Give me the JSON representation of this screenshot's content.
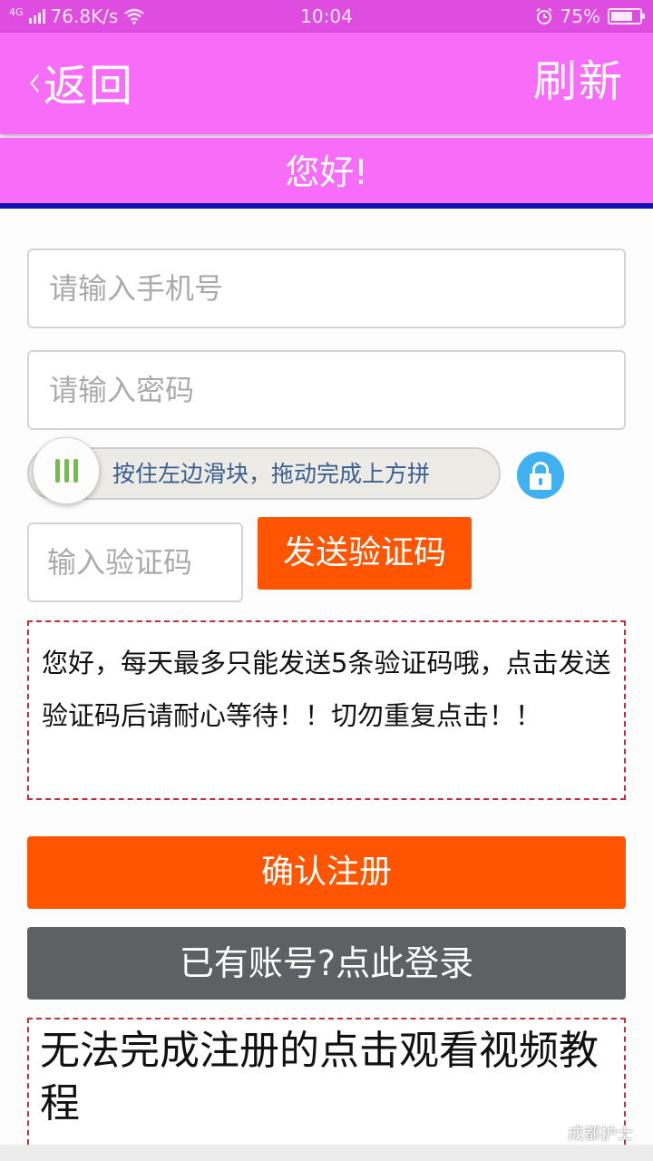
{
  "status_bar": {
    "network_type": "4G",
    "speed": "76.8K/s",
    "time": "10:04",
    "battery_percent": "75%",
    "battery_level": 0.75
  },
  "nav": {
    "back_label": "返回",
    "refresh_label": "刷新"
  },
  "greeting": "您好!",
  "form": {
    "phone_placeholder": "请输入手机号",
    "password_placeholder": "请输入密码",
    "slider_text": "按住左边滑块，拖动完成上方拼",
    "code_placeholder": "输入验证码",
    "send_code_label": "发送验证码"
  },
  "notice_text": "您好，每天最多只能发送5条验证码哦，点击发送验证码后请耐心等待！！切勿重复点击！！",
  "buttons": {
    "confirm_label": "确认注册",
    "login_label": "已有账号?点此登录"
  },
  "tutorial_text": "无法完成注册的点击观看视频教程",
  "watermark_text": "成都护士",
  "colors": {
    "header": "#f86df7",
    "status": "#de4de0",
    "accent_orange": "#ff5500",
    "dark_button": "#5f6063",
    "lock_blue": "#3fb0f0",
    "divider_blue": "#1010b4"
  },
  "icons": [
    "signal-icon",
    "wifi-icon",
    "alarm-icon",
    "battery-icon",
    "back-chevron-icon",
    "slider-grip-icon",
    "lock-icon"
  ]
}
